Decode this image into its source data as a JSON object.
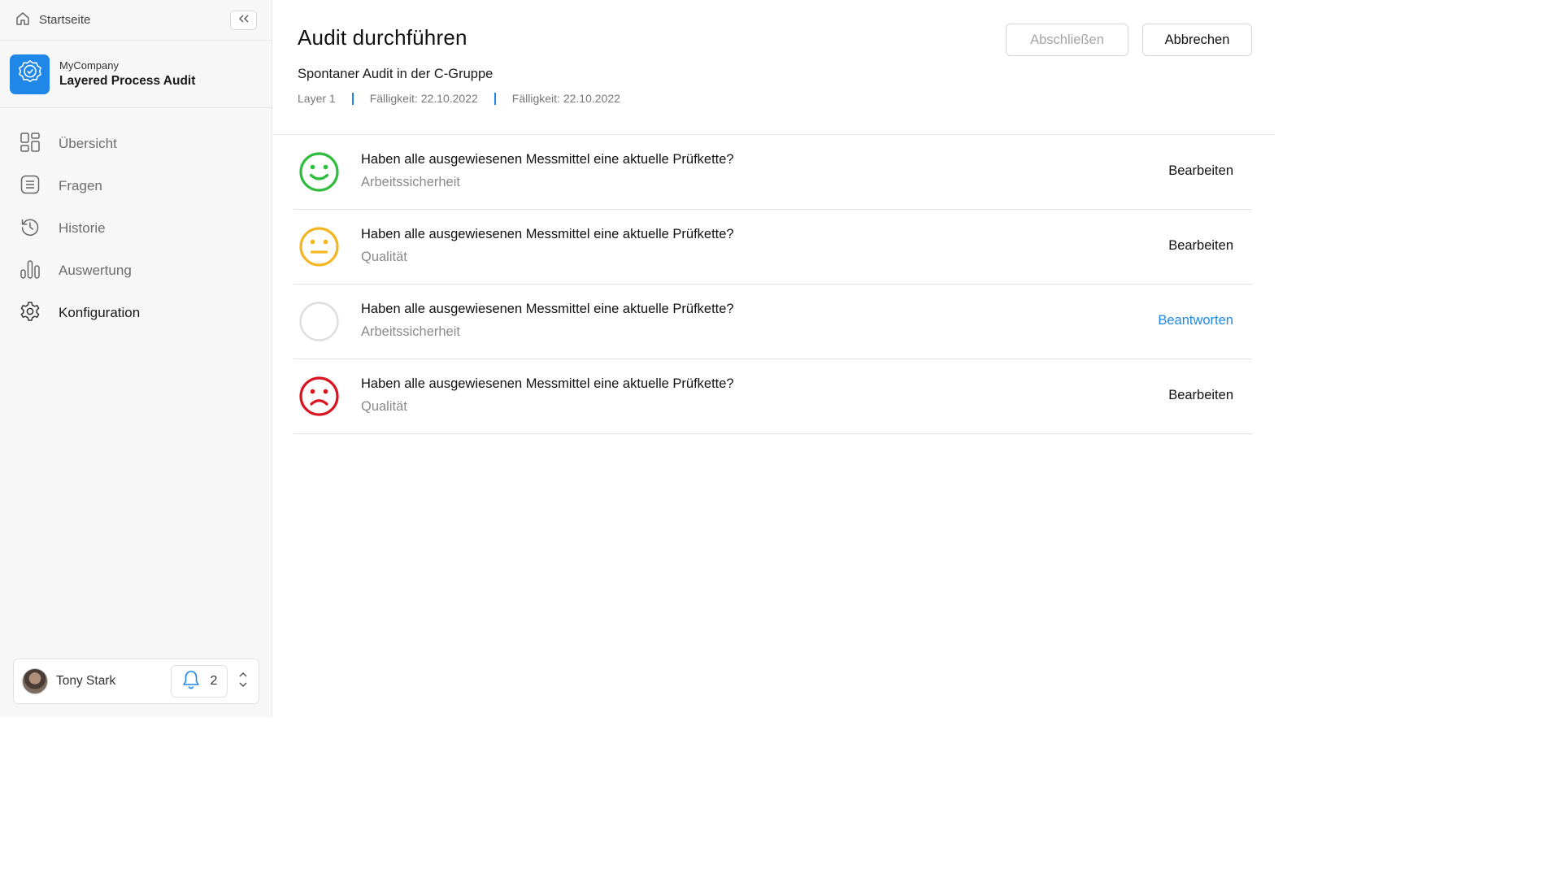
{
  "sidebar": {
    "home_label": "Startseite",
    "company": "MyCompany",
    "app_name": "Layered Process Audit",
    "nav": [
      {
        "label": "Übersicht",
        "icon": "grid-icon"
      },
      {
        "label": "Fragen",
        "icon": "list-document-icon"
      },
      {
        "label": "Historie",
        "icon": "history-icon"
      },
      {
        "label": "Auswertung",
        "icon": "bar-chart-icon"
      },
      {
        "label": "Konfiguration",
        "icon": "gear-icon"
      }
    ],
    "active_item": "Konfiguration",
    "user": {
      "name": "Tony Stark",
      "notifications": "2"
    }
  },
  "header": {
    "title": "Audit durchführen",
    "subtitle": "Spontaner Audit in der C-Gruppe",
    "meta": [
      "Layer 1",
      "Fälligkeit: 22.10.2022",
      "Fälligkeit: 22.10.2022"
    ],
    "finish_label": "Abschließen",
    "cancel_label": "Abbrechen"
  },
  "questions": [
    {
      "text": "Haben alle ausgewiesenen Messmittel eine aktuelle Prüfkette?",
      "category": "Arbeitssicherheit",
      "status": "happy",
      "action": "Bearbeiten"
    },
    {
      "text": "Haben alle ausgewiesenen Messmittel eine aktuelle Prüfkette?",
      "category": "Qualität",
      "status": "neutral",
      "action": "Bearbeiten"
    },
    {
      "text": "Haben alle ausgewiesenen Messmittel eine aktuelle Prüfkette?",
      "category": "Arbeitssicherheit",
      "status": "unanswered",
      "action": "Beantworten"
    },
    {
      "text": "Haben alle ausgewiesenen Messmittel eine aktuelle Prüfkette?",
      "category": "Qualität",
      "status": "sad",
      "action": "Bearbeiten"
    }
  ],
  "colors": {
    "accent": "#1e87e8",
    "happy": "#2ebd3c",
    "neutral": "#f3b623",
    "sad": "#d9141e",
    "unanswered": "#dedede"
  }
}
